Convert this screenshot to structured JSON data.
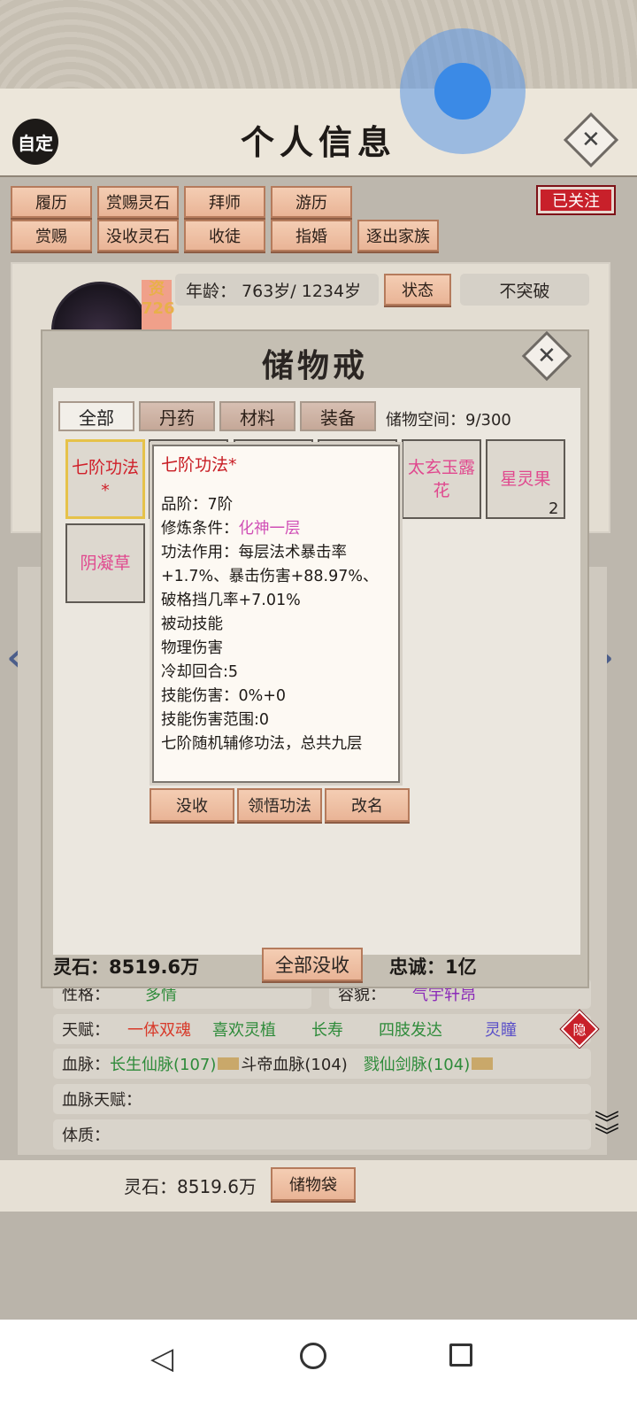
{
  "header": {
    "title": "个人信息",
    "auto_label": "自定"
  },
  "actions": {
    "row1": [
      "履历",
      "赏赐灵石",
      "拜师",
      "游历"
    ],
    "row2": [
      "赏赐",
      "没收灵石",
      "收徒",
      "指婚",
      "逐出家族"
    ],
    "follow": "已关注"
  },
  "profile": {
    "badge_label": "资",
    "badge_value": "726",
    "age": "年龄： 763岁/ 1234岁",
    "status_button": "状态",
    "breakthrough": "不突破"
  },
  "lower": {
    "personality_label": "性格：",
    "personality_value": "多情",
    "looks_label": "容貌：",
    "looks_value": "气宇轩昂",
    "talent_label": "天赋：",
    "talents": [
      {
        "text": "一体双魂",
        "color": "#d83a2a"
      },
      {
        "text": "喜欢灵植",
        "color": "#2e8b3a"
      },
      {
        "text": "长寿",
        "color": "#2e8b3a"
      },
      {
        "text": "四肢发达",
        "color": "#2e8b3a"
      },
      {
        "text": "灵瞳",
        "color": "#5a4fc8"
      }
    ],
    "hidden_badge": "隐",
    "bloodline_label": "血脉：",
    "bloodline_1": "长生仙脉(107)",
    "bloodline_2": "斗帝血脉(104)",
    "bloodline_3": "戮仙剑脉(104)",
    "bloodline_talent_label": "血脉天赋：",
    "constitution_label": "体质：",
    "spirit_stones": "灵石：8519.6万",
    "storage_bag": "储物袋"
  },
  "modal": {
    "title": "储物戒",
    "tabs": [
      "全部",
      "丹药",
      "材料",
      "装备"
    ],
    "capacity": "储物空间：9/300",
    "items": [
      {
        "name": "七阶功法\n*",
        "color": "#d0202a"
      },
      {
        "name": "太玄玉露\n花",
        "color": "#e0488e"
      },
      {
        "name": "星灵果",
        "color": "#e0488e",
        "count": "2"
      },
      {
        "name": "阴凝草",
        "color": "#e0488e"
      }
    ],
    "tooltip": {
      "title": "七阶功法*",
      "grade": "品阶：7阶",
      "cond_label": "修炼条件：",
      "cond_value": "化神一层",
      "effect": "功法作用：每层法术暴击率+1.7%、暴击伤害+88.97%、破格挡几率+7.01%",
      "passive": "被动技能",
      "physical": "物理伤害",
      "cooldown": "冷却回合:5",
      "damage": "技能伤害：0%+0",
      "range": "技能伤害范围:0",
      "desc": "七阶随机辅修功法，总共九层"
    },
    "buttons": [
      "没收",
      "领悟功法",
      "改名"
    ],
    "footer_stones": "灵石：8519.6万",
    "confiscate_all": "全部没收",
    "loyalty": "忠诚：1亿"
  }
}
